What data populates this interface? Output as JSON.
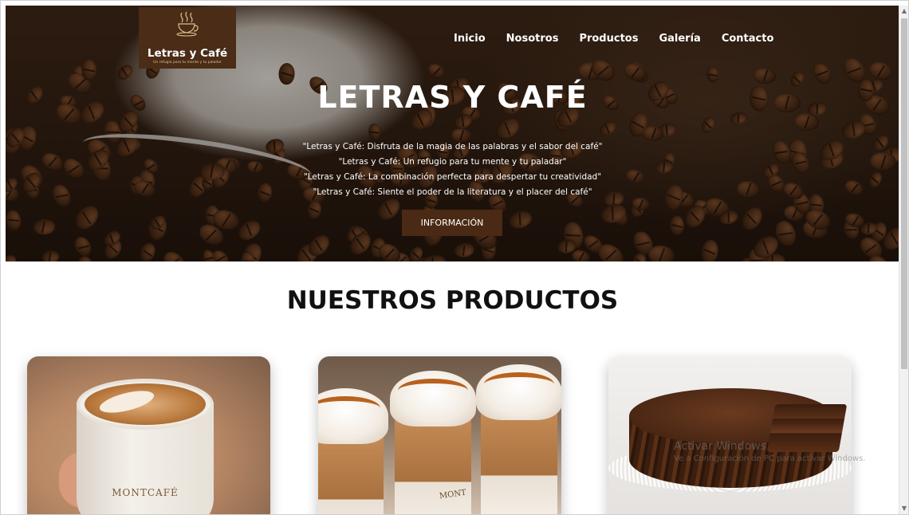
{
  "site": {
    "logo": {
      "name": "Letras y Café",
      "tagline": "Un refugio para tu mente y tu paladar",
      "icon": "coffee-cup-icon"
    },
    "nav": [
      {
        "label": "Inicio"
      },
      {
        "label": "Nosotros"
      },
      {
        "label": "Productos"
      },
      {
        "label": "Galería"
      },
      {
        "label": "Contacto"
      }
    ]
  },
  "hero": {
    "title": "LETRAS Y CAFÉ",
    "quotes": [
      "\"Letras y Café: Disfruta de la magia de las palabras y el sabor del café\"",
      "\"Letras y Café: Un refugio para tu mente y tu paladar\"",
      "\"Letras y Café: La combinación perfecta para despertar tu creatividad\"",
      "\"Letras y Café: Siente el poder de la literatura y el placer del café\""
    ],
    "button_label": "INFORMACIÓN"
  },
  "products": {
    "title": "NUESTROS PRODUCTOS",
    "cards": [
      {
        "image": "latte-cup-image",
        "brand": "MONTCAFÉ"
      },
      {
        "image": "frappe-drinks-image",
        "brand": "MONT"
      },
      {
        "image": "chocolate-cake-image"
      }
    ]
  },
  "overlay": {
    "watermark_title": "Activar Windows",
    "watermark_sub": "Ve a Configuración de PC para activar Windows."
  },
  "colors": {
    "accent": "#4a2a14",
    "logo_bg": "#4a2c17",
    "logo_tagline": "#d9c08a",
    "text_dark": "#111111"
  }
}
